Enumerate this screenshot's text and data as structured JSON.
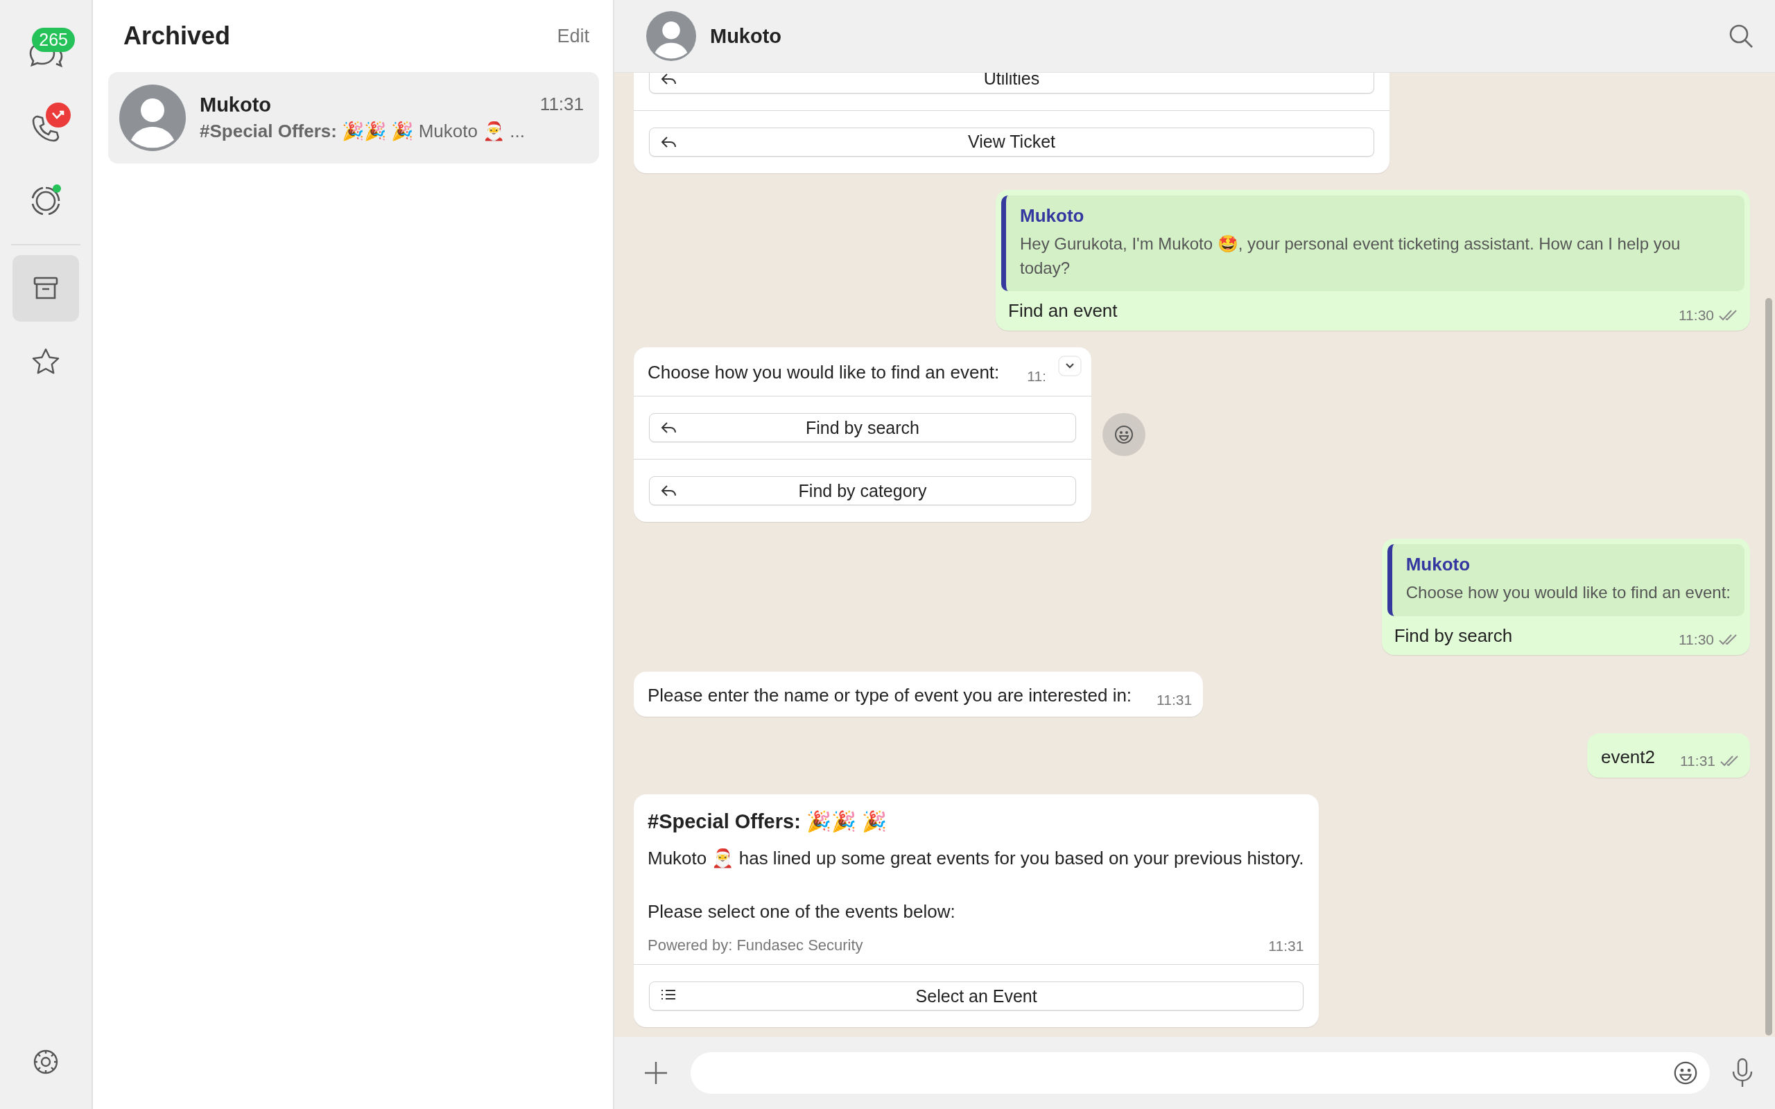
{
  "rail": {
    "items": [
      {
        "kind": "chats",
        "badge": "265",
        "selected": false
      },
      {
        "kind": "calls",
        "missed": true,
        "selected": false
      },
      {
        "kind": "status",
        "unseen": true,
        "selected": false
      },
      {
        "kind": "archive",
        "selected": true
      },
      {
        "kind": "starred",
        "selected": false
      }
    ]
  },
  "chat_list": {
    "title": "Archived",
    "edit": "Edit",
    "chats": [
      {
        "name": "Mukoto",
        "preview": "**#Special Offers:** 🎉🎉 🎉 Mukoto 🎅 ...",
        "time": "11:31",
        "selected": true
      }
    ]
  },
  "conversation": {
    "name": "Mukoto",
    "messages": [
      {
        "kind": "buttons",
        "outgoing": false,
        "buttons": [
          "Utilities",
          "View Ticket"
        ]
      },
      {
        "kind": "reply",
        "outgoing": true,
        "quote_name": "Mukoto",
        "quote_text": "Hey Gurukota, I'm Mukoto 🤩, your personal event ticketing assistant. How can I help you today?",
        "text": "Find an event",
        "time": "11:30",
        "read": true
      },
      {
        "kind": "buttons",
        "outgoing": false,
        "text": "Choose how you would like to find an event:",
        "time": "11:",
        "menu": true,
        "react": true,
        "buttons": [
          "Find by search",
          "Find by category"
        ]
      },
      {
        "kind": "reply",
        "outgoing": true,
        "quote_name": "Mukoto",
        "quote_text": "Choose how you would like to find an event:",
        "text": "Find by search",
        "time": "11:30",
        "read": true
      },
      {
        "kind": "text",
        "outgoing": false,
        "text": "Please enter the name or type of event you are interested in:",
        "time": "11:31"
      },
      {
        "kind": "text",
        "outgoing": true,
        "text": "event2",
        "time": "11:31",
        "read": true
      },
      {
        "kind": "list",
        "outgoing": false,
        "header": "#Special Offers: 🎉🎉 🎉",
        "body": "Mukoto 🎅 has lined up some great events for you based on your previous history.",
        "body2": "Please select one of the events below:",
        "footer": "Powered by: Fundasec Security",
        "time": "11:31",
        "button": "Select an Event"
      }
    ]
  }
}
